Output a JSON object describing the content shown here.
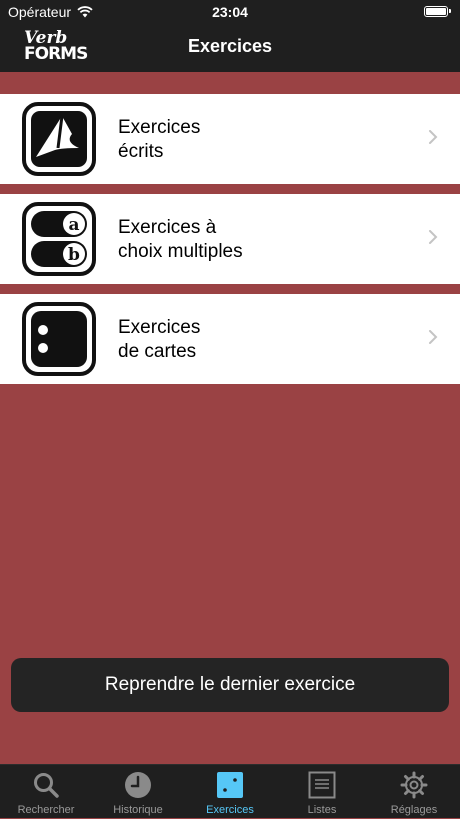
{
  "status_bar": {
    "carrier": "Opérateur",
    "time": "23:04"
  },
  "app": {
    "logo_line1": "Verb",
    "logo_line2": "FORMS",
    "title": "Exercices"
  },
  "exercises": [
    {
      "line1": "Exercices",
      "line2": "écrits",
      "icon": "pen-nib-icon"
    },
    {
      "line1": "Exercices à",
      "line2": "choix multiples",
      "icon": "ab-choice-icon",
      "icon_letters": [
        "a",
        "b"
      ]
    },
    {
      "line1": "Exercices",
      "line2": "de cartes",
      "icon": "cards-icon"
    }
  ],
  "resume_button": "Reprendre le dernier exercice",
  "tabs": [
    {
      "label": "Rechercher",
      "icon": "magnifier-icon"
    },
    {
      "label": "Historique",
      "icon": "clock-icon"
    },
    {
      "label": "Exercices",
      "icon": "dice-icon",
      "active": true
    },
    {
      "label": "Listes",
      "icon": "list-icon"
    },
    {
      "label": "Réglages",
      "icon": "gear-icon"
    }
  ],
  "colors": {
    "background": "#9a4244",
    "bars": "#1f1f1f",
    "active_tab": "#56c7f6",
    "inactive_tab": "#9a9a9a"
  }
}
